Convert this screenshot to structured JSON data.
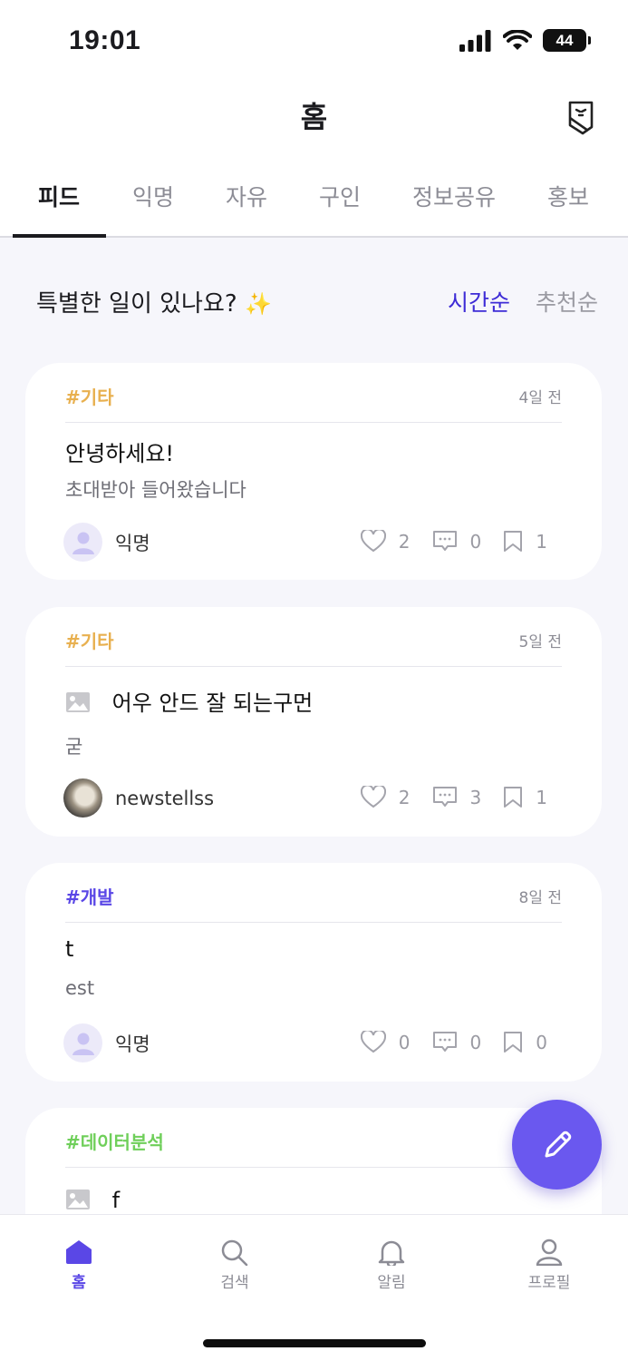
{
  "status_bar": {
    "time": "19:01",
    "battery": "44"
  },
  "header": {
    "title": "홈"
  },
  "tabs": [
    {
      "label": "피드"
    },
    {
      "label": "익명"
    },
    {
      "label": "자유"
    },
    {
      "label": "구인"
    },
    {
      "label": "정보공유"
    },
    {
      "label": "홍보"
    }
  ],
  "feed": {
    "prompt": "특별한 일이 있나요?",
    "prompt_emoji": "✨",
    "sort_time": "시간순",
    "sort_recommend": "추천순"
  },
  "posts": [
    {
      "tag": "#기타",
      "tag_color": "#e8b04f",
      "date": "4일 전",
      "title": "안녕하세요!",
      "body": "초대받아 들어왔습니다",
      "author": "익명",
      "likes": "2",
      "comments": "0",
      "bookmarks": "1"
    },
    {
      "tag": "#기타",
      "tag_color": "#e8b04f",
      "date": "5일 전",
      "title": "어우 안드 잘 되는구먼",
      "body": "굳",
      "author": "newstellss",
      "likes": "2",
      "comments": "3",
      "bookmarks": "1"
    },
    {
      "tag": "#개발",
      "tag_color": "#5a47e6",
      "date": "8일 전",
      "title": "t",
      "body": "est",
      "author": "익명",
      "likes": "0",
      "comments": "0",
      "bookmarks": "0"
    },
    {
      "tag": "#데이터분석",
      "tag_color": "#6fcf5a",
      "title": "f"
    }
  ],
  "bottom_nav": [
    {
      "label": "홈"
    },
    {
      "label": "검색"
    },
    {
      "label": "알림"
    },
    {
      "label": "프로필"
    }
  ],
  "colors": {
    "accent": "#5a47e6",
    "fab": "#6a58ef"
  }
}
